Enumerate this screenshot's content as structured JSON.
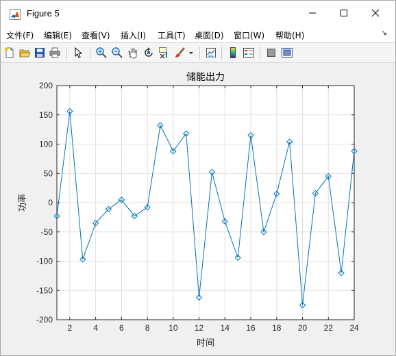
{
  "window": {
    "title": "Figure 5"
  },
  "menu": [
    {
      "label": "文件(F)"
    },
    {
      "label": "编辑(E)"
    },
    {
      "label": "查看(V)"
    },
    {
      "label": "插入(I)"
    },
    {
      "label": "工具(T)"
    },
    {
      "label": "桌面(D)"
    },
    {
      "label": "窗口(W)"
    },
    {
      "label": "帮助(H)"
    }
  ],
  "toolbar": {
    "icons": [
      "new-figure-icon",
      "open-file-icon",
      "save-icon",
      "print-icon",
      "pointer-icon",
      "zoom-in-icon",
      "zoom-out-icon",
      "pan-icon",
      "rotate-3d-icon",
      "data-cursor-icon",
      "brush-icon",
      "brush-dropdown-icon",
      "link-plot-icon",
      "colorbar-icon",
      "legend-icon",
      "hide-plot-tools-icon",
      "show-plot-tools-icon"
    ]
  },
  "colors": {
    "line": "#0072bd",
    "grid": "#e0e0e0",
    "axis": "#262626"
  },
  "chart_data": {
    "type": "line",
    "title": "储能出力",
    "xlabel": "时间",
    "ylabel": "功率",
    "xlim": [
      1,
      24
    ],
    "ylim": [
      -200,
      200
    ],
    "xticks": [
      2,
      4,
      6,
      8,
      10,
      12,
      14,
      16,
      18,
      20,
      22,
      24
    ],
    "yticks": [
      -200,
      -150,
      -100,
      -50,
      0,
      50,
      100,
      150,
      200
    ],
    "grid": true,
    "marker": "diamond",
    "series": [
      {
        "x": [
          1,
          2,
          3,
          4,
          5,
          6,
          7,
          8,
          9,
          10,
          11,
          12,
          13,
          14,
          15,
          16,
          17,
          18,
          19,
          20,
          21,
          22,
          23,
          24
        ],
        "values": [
          -23,
          156,
          -97,
          -35,
          -11,
          5,
          -23,
          -8,
          132,
          88,
          118,
          -162,
          52,
          -32,
          -94,
          115,
          -50,
          15,
          104,
          -175,
          16,
          45,
          -120,
          88
        ]
      }
    ]
  }
}
